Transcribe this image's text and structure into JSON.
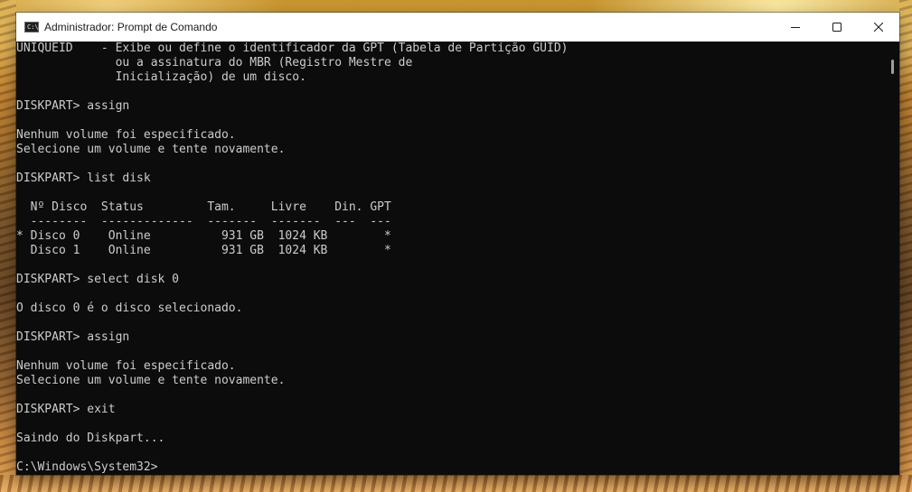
{
  "window": {
    "title": "Administrador: Prompt de Comando",
    "icon": "cmd-icon",
    "icon_text": "C:\\"
  },
  "controls": {
    "minimize_icon": "minimize-icon",
    "maximize_icon": "maximize-icon",
    "close_icon": "close-icon"
  },
  "console": {
    "lines": [
      "UNIQUEID    - Exibe ou define o identificador da GPT (Tabela de Partição GUID)",
      "              ou a assinatura do MBR (Registro Mestre de",
      "              Inicialização) de um disco.",
      "",
      "DISKPART> assign",
      "",
      "Nenhum volume foi especificado.",
      "Selecione um volume e tente novamente.",
      "",
      "DISKPART> list disk",
      "",
      "  Nº Disco  Status         Tam.     Livre    Din. GPT",
      "  --------  -------------  -------  -------  ---  ---",
      "* Disco 0    Online          931 GB  1024 KB        *",
      "  Disco 1    Online          931 GB  1024 KB        *",
      "",
      "DISKPART> select disk 0",
      "",
      "O disco 0 é o disco selecionado.",
      "",
      "DISKPART> assign",
      "",
      "Nenhum volume foi especificado.",
      "Selecione um volume e tente novamente.",
      "",
      "DISKPART> exit",
      "",
      "Saindo do Diskpart...",
      "",
      "C:\\Windows\\System32>"
    ]
  },
  "colors": {
    "console_bg": "#0c0c0c",
    "console_text": "#cccccc",
    "titlebar_bg": "#ffffff"
  }
}
